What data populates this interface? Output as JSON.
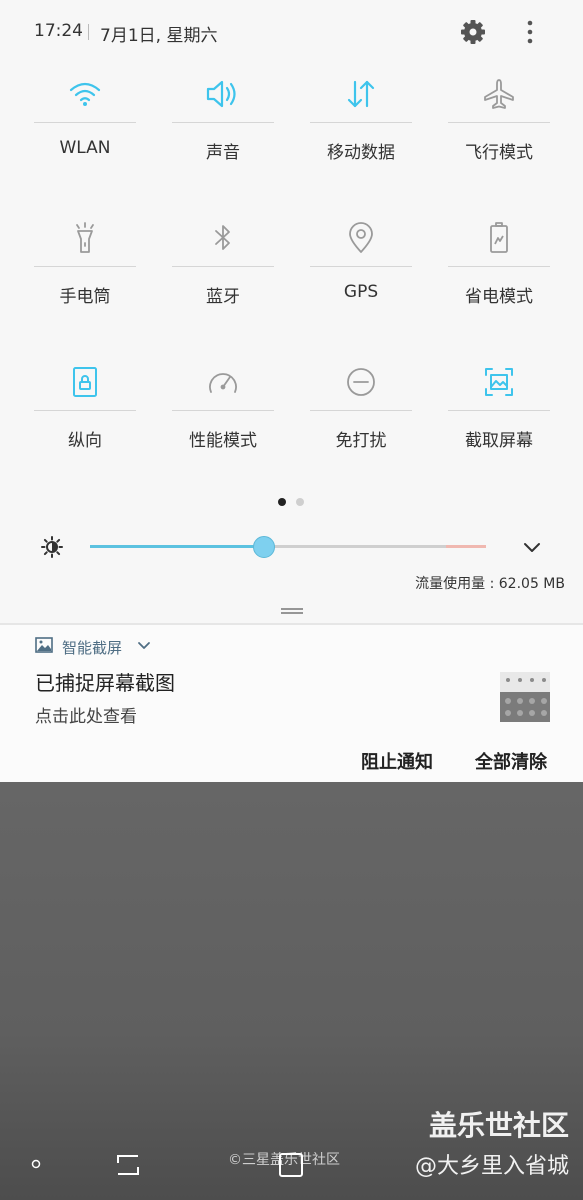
{
  "status": {
    "time": "17:24",
    "date": "7月1日, 星期六"
  },
  "quick_tiles": [
    {
      "label": "WLAN",
      "icon": "wifi-icon",
      "active": true
    },
    {
      "label": "声音",
      "icon": "sound-icon",
      "active": true
    },
    {
      "label": "移动数据",
      "icon": "mobile-data-icon",
      "active": true
    },
    {
      "label": "飞行模式",
      "icon": "airplane-icon",
      "active": false
    },
    {
      "label": "手电筒",
      "icon": "flashlight-icon",
      "active": false
    },
    {
      "label": "蓝牙",
      "icon": "bluetooth-icon",
      "active": false
    },
    {
      "label": "GPS",
      "icon": "location-icon",
      "active": false
    },
    {
      "label": "省电模式",
      "icon": "battery-saver-icon",
      "active": false
    },
    {
      "label": "纵向",
      "icon": "portrait-lock-icon",
      "active": true
    },
    {
      "label": "性能模式",
      "icon": "performance-icon",
      "active": false
    },
    {
      "label": "免打扰",
      "icon": "do-not-disturb-icon",
      "active": false
    },
    {
      "label": "截取屏幕",
      "icon": "screenshot-icon",
      "active": true
    }
  ],
  "pager": {
    "current": 1,
    "total": 2
  },
  "brightness": {
    "level": 0.44
  },
  "data_usage": "流量使用量 : 62.05 MB",
  "notification": {
    "app_name": "智能截屏",
    "title": "已捕捉屏幕截图",
    "text": "点击此处查看",
    "block_label": "阻止通知",
    "clear_all_label": "全部清除"
  },
  "watermark": {
    "line1": "盖乐世社区",
    "line2": "@大乡里入省城",
    "copyright": "©三星盖乐世社区"
  },
  "colors": {
    "accent": "#3ec4ec",
    "inactive": "#9a9a9a",
    "panel_bg": "#f7f7f7",
    "shade_bg": "#5e5e5e"
  }
}
